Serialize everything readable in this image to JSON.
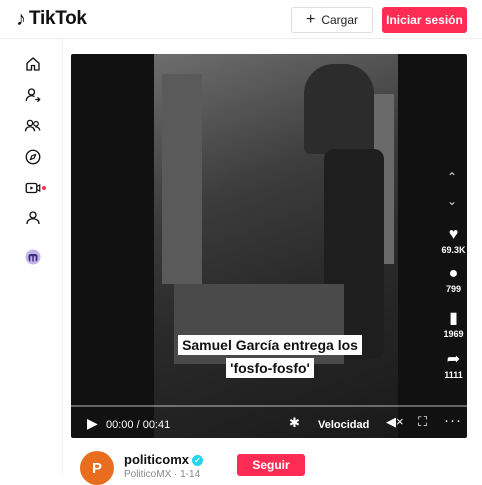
{
  "header": {
    "logo_glyph": "♪",
    "logo_text": "TikTok",
    "upload_plus": "+",
    "upload_label": "Cargar",
    "login_label": "Iniciar sesión"
  },
  "sidebar": {
    "icons": [
      "home-icon",
      "following-icon",
      "friends-icon",
      "explore-icon",
      "live-icon",
      "profile-icon",
      "creator-icon"
    ]
  },
  "video": {
    "caption_line1": "Samuel García entrega los",
    "caption_line2": "'fosfo-fosfo'",
    "time": "00:00 / 00:41",
    "speed_label": "Velocidad",
    "progress": 0.0,
    "actions": [
      {
        "icon": "heart-icon",
        "count": "69.3K"
      },
      {
        "icon": "comment-icon",
        "count": "799"
      },
      {
        "icon": "bookmark-icon",
        "count": "1969"
      },
      {
        "icon": "share-icon",
        "count": "1111"
      }
    ]
  },
  "author": {
    "avatar_letter": "P",
    "username": "politicomx",
    "verified_mark": "✓",
    "subtitle": "PoliticoMX · 1-14",
    "follow_label": "Seguir"
  },
  "colors": {
    "accent": "#fe2c55",
    "avatar_bg": "#e96d1f",
    "verified": "#20d5ec"
  }
}
